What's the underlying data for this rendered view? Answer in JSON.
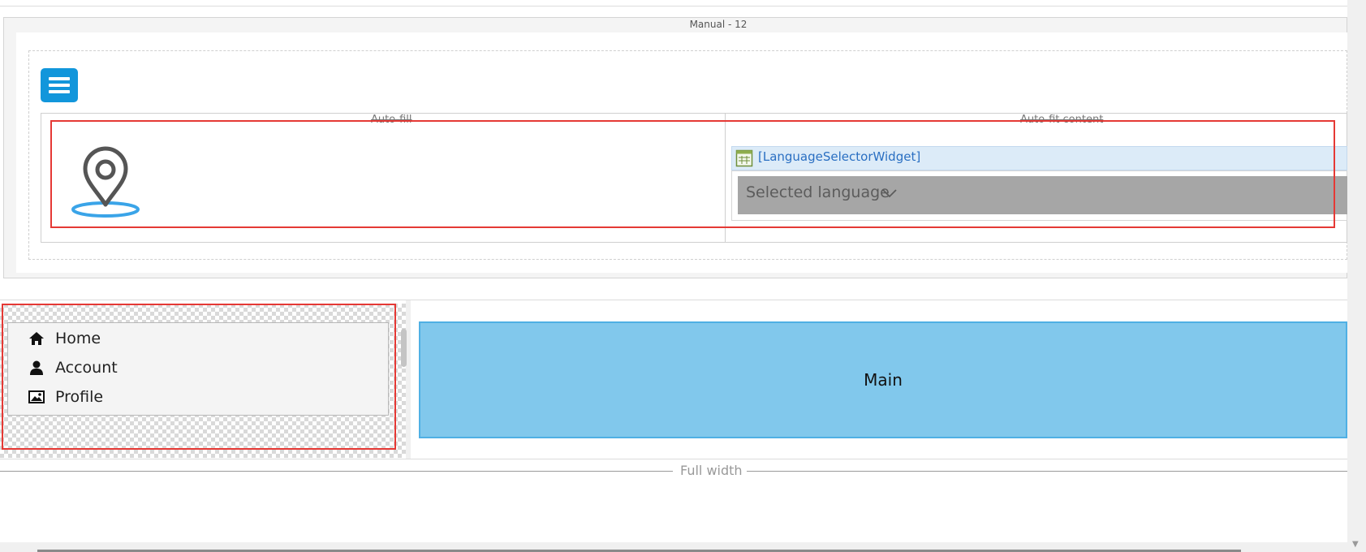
{
  "manual_section": {
    "title": "Manual - 12"
  },
  "menu_button": {
    "icon": "hamburger-menu-icon",
    "color": "#1296db"
  },
  "layout_table": {
    "col_autofill_label": "Auto-fill",
    "col_autofit_label": "Auto-fit content",
    "location_icon": "map-pin-icon"
  },
  "language_widget": {
    "title": "[LanguageSelectorWidget]",
    "dropdown_label": "Selected language",
    "icon": "widget-grid-icon"
  },
  "side_nav": {
    "items": [
      {
        "label": "Home",
        "icon": "home-icon"
      },
      {
        "label": "Account",
        "icon": "user-icon"
      },
      {
        "label": "Profile",
        "icon": "image-icon"
      }
    ]
  },
  "main_panel": {
    "label": "Main",
    "color": "#81c8ec"
  },
  "full_width": {
    "label": "Full width"
  },
  "highlight_color": "#e53935"
}
